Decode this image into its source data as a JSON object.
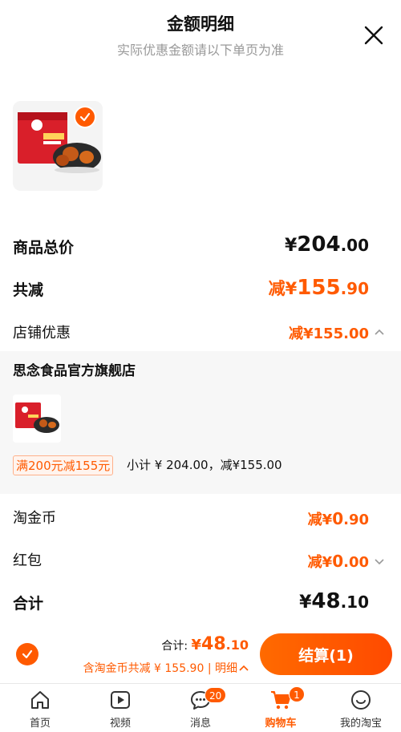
{
  "header": {
    "title": "金额明细",
    "subtitle": "实际优惠金额请以下单页为准"
  },
  "summary": {
    "total_label": "商品总价",
    "total_currency": "¥",
    "total_int": "204",
    "total_dec": ".00",
    "reduce_label": "共减",
    "reduce_prefix": "减¥",
    "reduce_int": "155",
    "reduce_dec": ".90",
    "store_label": "店铺优惠",
    "store_prefix": "减¥",
    "store_int": "155",
    "store_dec": ".00"
  },
  "store_detail": {
    "shop_name": "思念食品官方旗舰店",
    "promo_tag": "满200元减155元",
    "subtotal_text": "小计 ¥ 204.00，减¥155.00"
  },
  "extras": {
    "coin_label": "淘金币",
    "coin_prefix": "减¥",
    "coin_int": "0",
    "coin_dec": ".90",
    "redpacket_label": "红包",
    "redpacket_prefix": "减¥",
    "redpacket_int": "0",
    "redpacket_dec": ".00",
    "sum_label": "合计",
    "sum_currency": "¥",
    "sum_int": "48",
    "sum_dec": ".10"
  },
  "checkout": {
    "total_label": "合计: ",
    "total_currency": "¥",
    "total_int": "48",
    "total_dec": ".10",
    "discount_text": "含淘金币共减 ¥ 155.90 | 明细",
    "pay_label": "结算(1)"
  },
  "tabbar": {
    "home": "首页",
    "video": "视频",
    "messages": "消息",
    "messages_badge": "20",
    "cart": "购物车",
    "cart_badge": "1",
    "mine": "我的淘宝"
  },
  "colors": {
    "accent": "#ff5a00"
  }
}
